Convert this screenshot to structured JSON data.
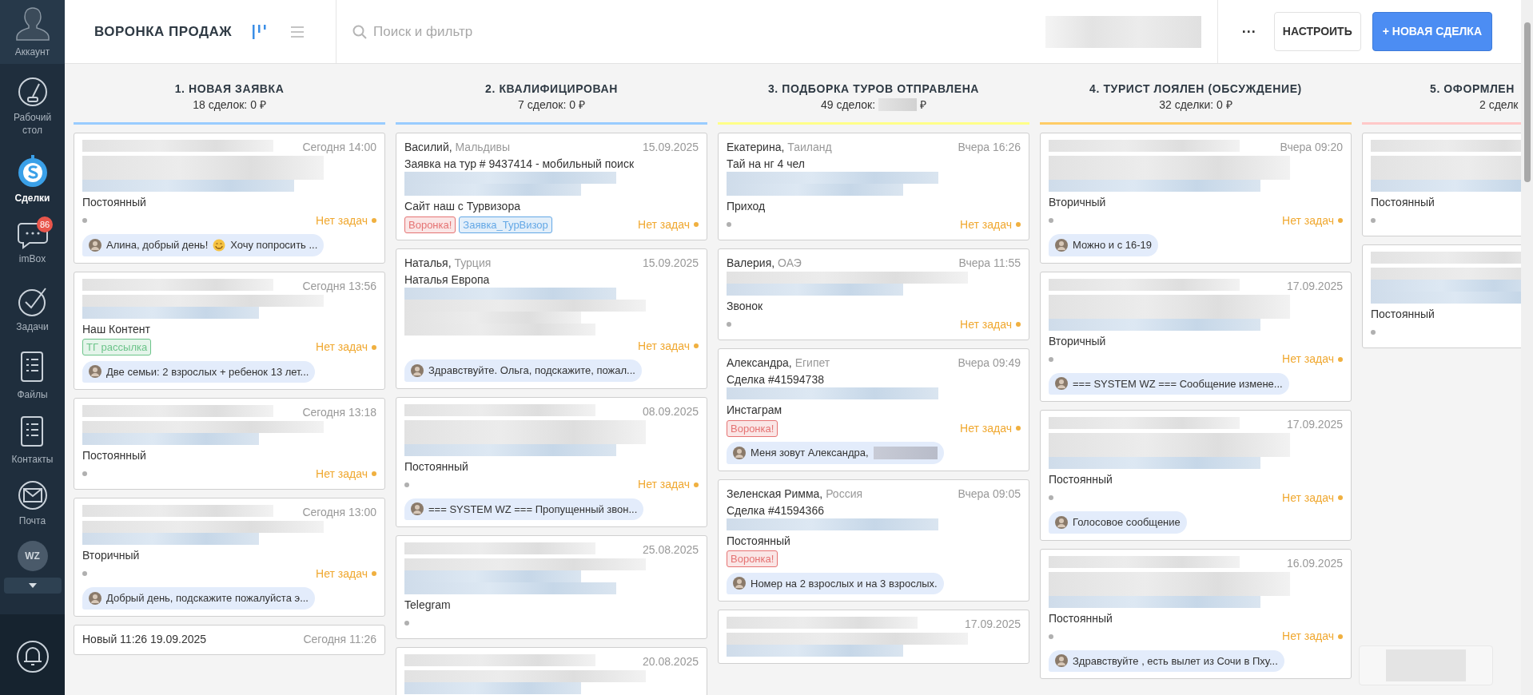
{
  "sidebar": {
    "account": "Аккаунт",
    "items": [
      {
        "label": "Рабочий стол",
        "selected": false
      },
      {
        "label": "Сделки",
        "selected": true
      },
      {
        "label": "imBox",
        "selected": false,
        "badge": "86"
      },
      {
        "label": "Задачи",
        "selected": false
      },
      {
        "label": "Файлы",
        "selected": false
      },
      {
        "label": "Контакты",
        "selected": false
      },
      {
        "label": "Почта",
        "selected": false
      }
    ],
    "app_badge": "WZ"
  },
  "header": {
    "title": "ВОРОНКА ПРОДАЖ",
    "views": [
      {
        "kind": "kanban",
        "selected": true
      },
      {
        "kind": "list",
        "selected": false
      }
    ],
    "search": {
      "placeholder": "Поиск и фильтр"
    },
    "more": "···",
    "configure": "НАСТРОИТЬ",
    "new_deal": "+ НОВАЯ СДЕЛКА"
  },
  "columns": [
    {
      "title": "1. НОВАЯ ЗАЯВКА",
      "count": "18 сделок: 0 ₽",
      "color": "#99ccff",
      "clipped": false,
      "cards": [
        {
          "date": "Сегодня 14:00",
          "blur": [
            {
              "kind": "gray"
            },
            {
              "kind": "gray"
            },
            {
              "kind": "gray"
            },
            {
              "kind": "blue"
            }
          ],
          "source": "Постоянный",
          "status_dot": true,
          "tasks": "Нет задач",
          "message": {
            "text": "Алина, добрый день!",
            "after_icon": "Хочу попросить ..."
          }
        },
        {
          "date": "Сегодня 13:56",
          "blur": [
            {
              "kind": "gray"
            },
            {
              "kind": "gray"
            },
            {
              "kind": "blue"
            }
          ],
          "source": "Наш Контент",
          "tags": [
            {
              "label": "ТГ рассылка",
              "color": "#6cc48a"
            }
          ],
          "tasks": "Нет задач",
          "message": {
            "text": "Две семьи: 2 взрослых + ребенок 13 лет..."
          }
        },
        {
          "date": "Сегодня 13:18",
          "blur": [
            {
              "kind": "gray"
            },
            {
              "kind": "gray"
            },
            {
              "kind": "blue"
            }
          ],
          "source": "Постоянный",
          "status_dot": true,
          "tasks": "Нет задач"
        },
        {
          "date": "Сегодня 13:00",
          "blur": [
            {
              "kind": "gray"
            },
            {
              "kind": "gray"
            },
            {
              "kind": "blue"
            }
          ],
          "source": "Вторичный",
          "status_dot": true,
          "tasks": "Нет задач",
          "message": {
            "text": "Добрый день, подскажите пожалуйста э..."
          }
        },
        {
          "name": "Новый 11:26 19.09.2025",
          "date": "Сегодня 11:26"
        }
      ]
    },
    {
      "title": "2. КВАЛИФИЦИРОВАН",
      "count": "7 сделок: 0 ₽",
      "color": "#99ccff",
      "clipped": false,
      "cards": [
        {
          "name": "Василий,",
          "region": "Мальдивы",
          "date": "15.09.2025",
          "lines": [
            "Заявка на тур # 9437414 - мобильный поиск"
          ],
          "blur": [
            {
              "kind": "blue"
            },
            {
              "kind": "blue"
            }
          ],
          "source": "Сайт наш с Турвизора",
          "tags": [
            {
              "label": "Воронка!",
              "color": "#e57373"
            },
            {
              "label": "Заявка_ТурВизор",
              "color": "#64a8e6"
            }
          ],
          "tasks": "Нет задач"
        },
        {
          "name": "Наталья,",
          "region": "Турция",
          "date": "15.09.2025",
          "lines": [
            "Наталья Европа"
          ],
          "blur": [
            {
              "kind": "blue"
            },
            {
              "kind": "gray"
            },
            {
              "kind": "gray"
            },
            {
              "kind": "gray"
            }
          ],
          "tasks": "Нет задач",
          "message": {
            "text": "Здравствуйте. Ольга, подскажите, пожал..."
          }
        },
        {
          "date": "08.09.2025",
          "blur": [
            {
              "kind": "gray"
            },
            {
              "kind": "gray"
            },
            {
              "kind": "gray"
            },
            {
              "kind": "blue"
            }
          ],
          "source": "Постоянный",
          "status_dot": true,
          "tasks": "Нет задач",
          "message": {
            "text": "=== SYSTEM WZ === Пропущенный звон..."
          }
        },
        {
          "date": "25.08.2025",
          "blur": [
            {
              "kind": "gray"
            },
            {
              "kind": "gray"
            },
            {
              "kind": "blue"
            },
            {
              "kind": "blue"
            }
          ],
          "source": "Telegram",
          "status_dot": true
        },
        {
          "date": "20.08.2025",
          "blur": [
            {
              "kind": "gray"
            },
            {
              "kind": "gray"
            },
            {
              "kind": "blue"
            }
          ]
        }
      ]
    },
    {
      "title": "3. ПОДБОРКА ТУРОВ ОТПРАВЛЕНА",
      "count": "49 сделок:",
      "count_blur": true,
      "currency": "₽",
      "color": "#ffff88",
      "clipped": false,
      "cards": [
        {
          "name": "Екатерина,",
          "region": "Таиланд",
          "date": "Вчера 16:26",
          "lines": [
            "Тай на нг 4 чел"
          ],
          "blur": [
            {
              "kind": "blue"
            },
            {
              "kind": "blue"
            }
          ],
          "source": "Приход",
          "status_dot": true,
          "tasks": "Нет задач"
        },
        {
          "name": "Валерия,",
          "region": "ОАЭ",
          "date": "Вчера 11:55",
          "blur": [
            {
              "kind": "gray"
            },
            {
              "kind": "blue"
            }
          ],
          "source": "Звонок",
          "status_dot": true,
          "tasks": "Нет задач"
        },
        {
          "name": "Александра,",
          "region": "Египет",
          "date": "Вчера 09:49",
          "lines": [
            "Сделка #41594738"
          ],
          "blur": [
            {
              "kind": "blue"
            }
          ],
          "source": "Инстаграм",
          "tags": [
            {
              "label": "Воронка!",
              "color": "#e57373"
            }
          ],
          "tasks": "Нет задач",
          "message": {
            "text": "Меня зовут Александра,",
            "blur_tail": true
          }
        },
        {
          "name": "Зеленская Римма,",
          "region": "Россия",
          "date": "Вчера 09:05",
          "lines": [
            "Сделка #41594366"
          ],
          "blur": [
            {
              "kind": "blue"
            }
          ],
          "source": "Постоянный",
          "tags": [
            {
              "label": "Воронка!",
              "color": "#e57373"
            }
          ],
          "message": {
            "text": "Номер на 2 взрослых и на 3 взрослых."
          }
        },
        {
          "date": "17.09.2025",
          "blur": [
            {
              "kind": "gray"
            },
            {
              "kind": "gray"
            },
            {
              "kind": "blue"
            }
          ]
        }
      ]
    },
    {
      "title": "4. ТУРИСТ ЛОЯЛЕН (ОБСУЖДЕНИЕ)",
      "count": "32 сделки: 0 ₽",
      "color": "#ffcc66",
      "clipped": false,
      "cards": [
        {
          "date": "Вчера 09:20",
          "blur": [
            {
              "kind": "gray"
            },
            {
              "kind": "gray"
            },
            {
              "kind": "gray"
            },
            {
              "kind": "blue"
            }
          ],
          "source": "Вторичный",
          "status_dot": true,
          "tasks": "Нет задач",
          "message": {
            "text": "Можно и с 16-19"
          }
        },
        {
          "date": "17.09.2025",
          "blur": [
            {
              "kind": "gray"
            },
            {
              "kind": "gray"
            },
            {
              "kind": "gray"
            },
            {
              "kind": "blue"
            }
          ],
          "source": "Вторичный",
          "status_dot": true,
          "tasks": "Нет задач",
          "message": {
            "text": "=== SYSTEM WZ === Сообщение измене..."
          }
        },
        {
          "date": "17.09.2025",
          "blur": [
            {
              "kind": "gray"
            },
            {
              "kind": "gray"
            },
            {
              "kind": "gray"
            },
            {
              "kind": "blue"
            }
          ],
          "source": "Постоянный",
          "status_dot": true,
          "tasks": "Нет задач",
          "message": {
            "text": "Голосовое сообщение"
          }
        },
        {
          "date": "16.09.2025",
          "blur": [
            {
              "kind": "gray"
            },
            {
              "kind": "gray"
            },
            {
              "kind": "gray"
            },
            {
              "kind": "blue"
            }
          ],
          "source": "Постоянный",
          "status_dot": true,
          "tasks": "Нет задач",
          "message": {
            "text": "Здравствуйте , есть вылет из Сочи в Пху..."
          }
        }
      ]
    },
    {
      "title": "5. ОФОРМЛЕН",
      "count": "2 сделк",
      "color": "#ffc8c8",
      "clipped": true,
      "cards": [
        {
          "blur": [
            {
              "kind": "gray"
            },
            {
              "kind": "gray"
            },
            {
              "kind": "gray"
            },
            {
              "kind": "blue"
            }
          ],
          "source": "Постоянный",
          "status_dot": true
        },
        {
          "blur": [
            {
              "kind": "gray"
            },
            {
              "kind": "gray"
            },
            {
              "kind": "blue"
            },
            {
              "kind": "blue"
            }
          ],
          "source": "Постоянный",
          "status_dot": true
        }
      ]
    }
  ]
}
